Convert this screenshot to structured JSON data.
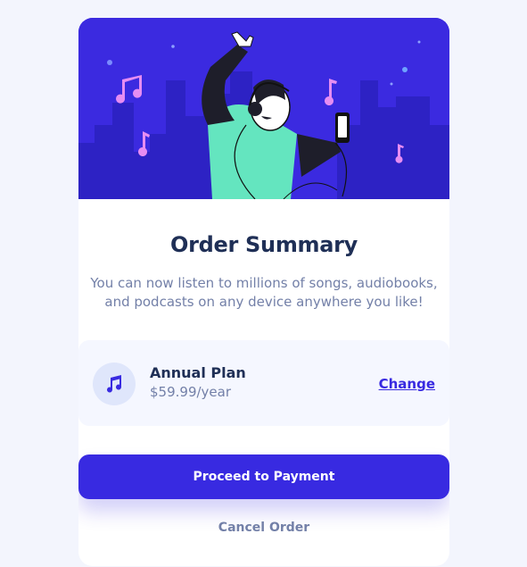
{
  "card": {
    "title": "Order Summary",
    "description": "You can now listen to millions of songs, audiobooks, and podcasts on any device anywhere you like!"
  },
  "plan": {
    "icon": "music-note-icon",
    "name": "Annual Plan",
    "price": "$59.99/year",
    "change_label": "Change"
  },
  "actions": {
    "proceed_label": "Proceed to Payment",
    "cancel_label": "Cancel Order"
  },
  "colors": {
    "accent": "#382ae1",
    "title": "#1f2f56",
    "muted": "#7380a8",
    "page_bg": "#f3f5fd",
    "hero_bg": "#3b2ae0",
    "plan_bg": "#f5f7ff"
  }
}
